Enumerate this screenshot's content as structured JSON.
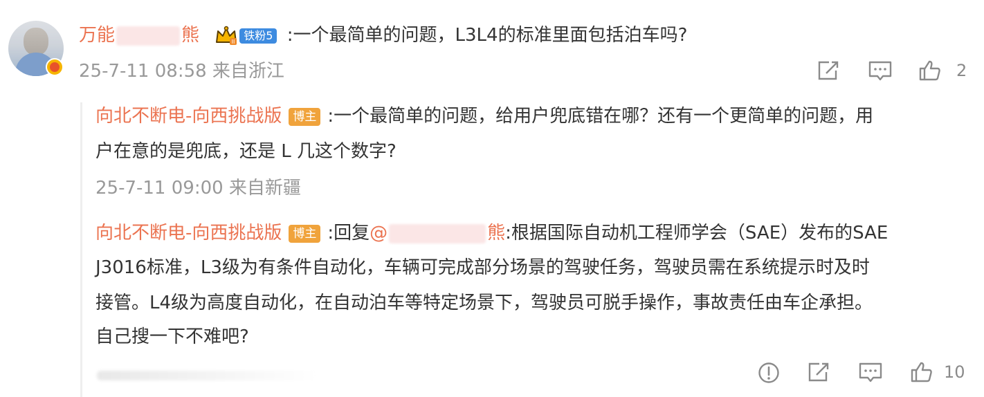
{
  "comment": {
    "user_name_prefix": "万能",
    "user_name_suffix": "熊",
    "fan_badge": "铁粉5",
    "text": ":一个最简单的问题，L3L4的标准里面包括泊车吗?",
    "timestamp": "25-7-11 08:58 来自浙江",
    "likes": "2"
  },
  "reply1": {
    "user_name": "向北不断电-向西挑战版",
    "badge": "博主",
    "text_line1": ":一个最简单的问题，给用户兜底错在哪？还有一个更简单的问题，用",
    "text_line2": "户在意的是兜底，还是 L 几这个数字?",
    "timestamp": "25-7-11 09:00 来自新疆"
  },
  "reply2": {
    "user_name": "向北不断电-向西挑战版",
    "badge": "博主",
    "reply_prefix": ":回复",
    "mention_prefix": "@",
    "mention_suffix": "熊",
    "text_line1": ":根据国际自动机工程师学会（SAE）发布的SAE",
    "text_line2": "J3016标准，L3级为有条件自动化，车辆可完成部分场景的驾驶任务，驾驶员需在系统提示时及时",
    "text_line3": "接管。L4级为高度自动化，在自动泊车等特定场景下，驾驶员可脱手操作，事故责任由车企承担。",
    "text_line4": "自己搜一下不难吧?",
    "likes": "10"
  },
  "colors": {
    "name": "#eb7350",
    "meta": "#999999",
    "fan_badge": "#3d8be0",
    "blogger_badge": "#f0a33c"
  },
  "icons": [
    "avatar",
    "verified-badge-icon",
    "crown-icon",
    "share-icon",
    "comment-icon",
    "like-icon",
    "report-icon"
  ]
}
